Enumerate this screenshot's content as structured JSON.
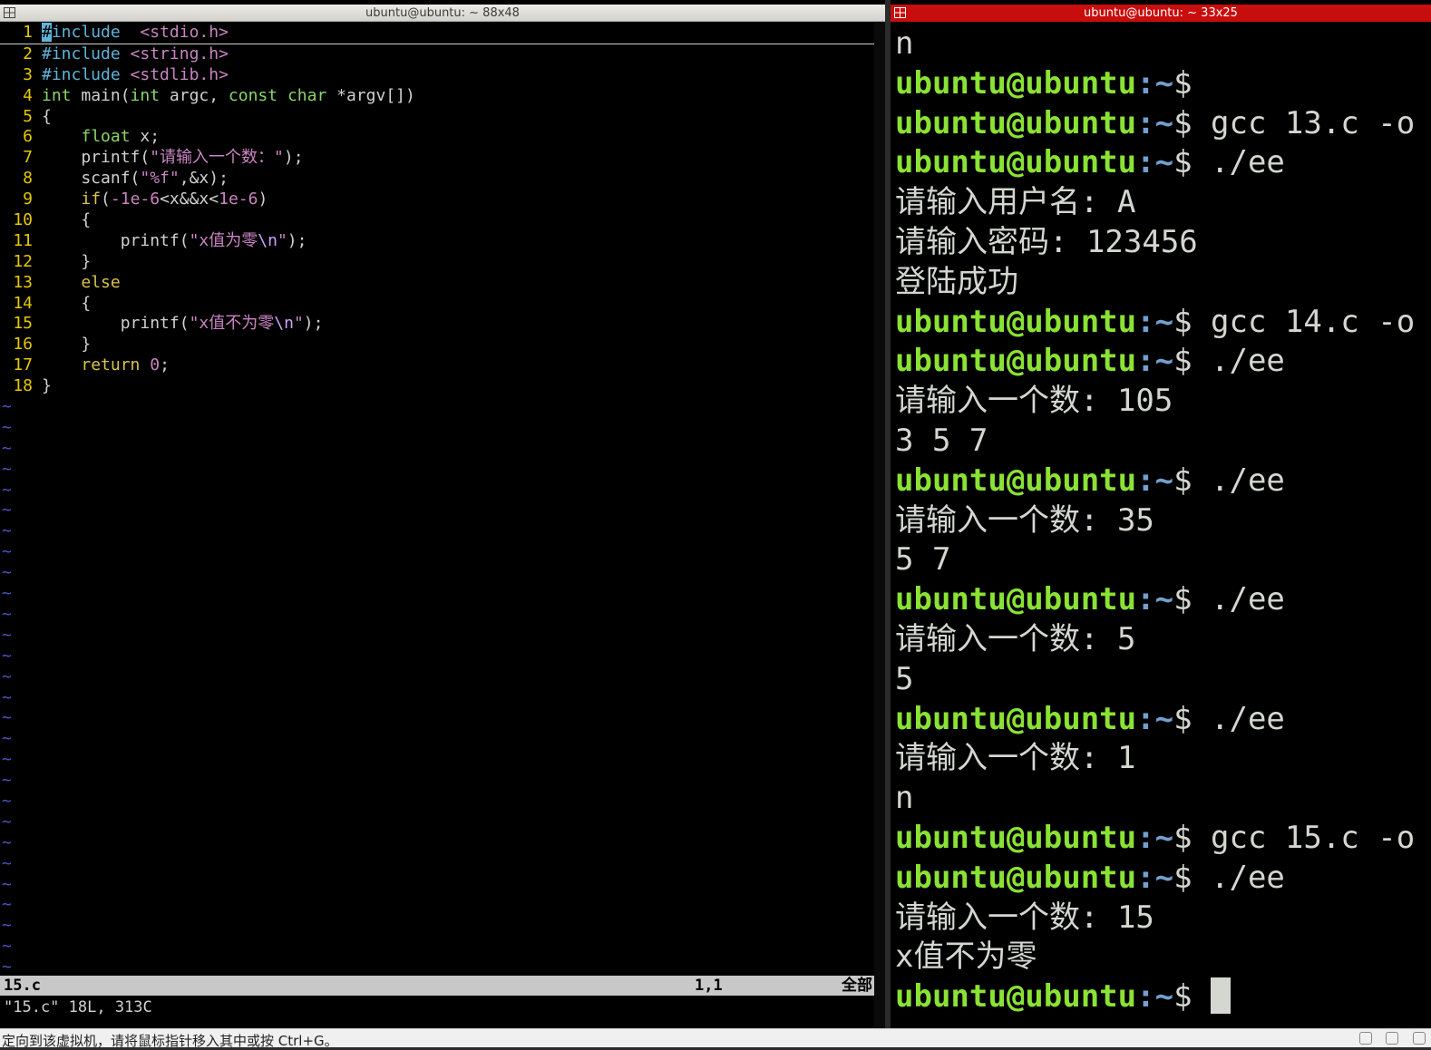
{
  "left_window": {
    "title": "ubuntu@ubuntu: ~ 88x48",
    "code": [
      {
        "n": "1",
        "parts": [
          [
            "cur",
            "#"
          ],
          [
            "c-pre",
            "include"
          ],
          [
            "",
            "  "
          ],
          [
            "c-inc",
            "<stdio.h>"
          ]
        ]
      },
      {
        "n": "2",
        "parts": [
          [
            "c-pre",
            "#include"
          ],
          [
            "",
            " "
          ],
          [
            "c-inc",
            "<string.h>"
          ]
        ]
      },
      {
        "n": "3",
        "parts": [
          [
            "c-pre",
            "#include"
          ],
          [
            "",
            " "
          ],
          [
            "c-inc",
            "<stdlib.h>"
          ]
        ]
      },
      {
        "n": "4",
        "parts": [
          [
            "c-type",
            "int"
          ],
          [
            "",
            " main("
          ],
          [
            "c-type",
            "int"
          ],
          [
            "",
            " argc, "
          ],
          [
            "c-type",
            "const"
          ],
          [
            "",
            " "
          ],
          [
            "c-type",
            "char"
          ],
          [
            "",
            " *argv[])"
          ]
        ]
      },
      {
        "n": "5",
        "parts": [
          [
            "",
            "{"
          ]
        ]
      },
      {
        "n": "6",
        "parts": [
          [
            "",
            "    "
          ],
          [
            "c-type",
            "float"
          ],
          [
            "",
            " x;"
          ]
        ]
      },
      {
        "n": "7",
        "parts": [
          [
            "",
            "    printf("
          ],
          [
            "c-str",
            "\"请输入一个数：\""
          ],
          [
            "",
            ");"
          ]
        ]
      },
      {
        "n": "8",
        "parts": [
          [
            "",
            "    scanf("
          ],
          [
            "c-str",
            "\"%f\""
          ],
          [
            "",
            ",&x);"
          ]
        ]
      },
      {
        "n": "9",
        "parts": [
          [
            "",
            "    "
          ],
          [
            "c-kw",
            "if"
          ],
          [
            "",
            "("
          ],
          [
            "c-num",
            "-1e-6"
          ],
          [
            "",
            "<x&&x<"
          ],
          [
            "c-num",
            "1e-6"
          ],
          [
            "",
            ")"
          ]
        ]
      },
      {
        "n": "10",
        "parts": [
          [
            "",
            "    {"
          ]
        ]
      },
      {
        "n": "11",
        "parts": [
          [
            "",
            "        printf("
          ],
          [
            "c-str",
            "\"x值为零"
          ],
          [
            "c-esc",
            "\\n"
          ],
          [
            "c-str",
            "\""
          ],
          [
            "",
            ");"
          ]
        ]
      },
      {
        "n": "12",
        "parts": [
          [
            "",
            "    }"
          ]
        ]
      },
      {
        "n": "13",
        "parts": [
          [
            "",
            "    "
          ],
          [
            "c-kw",
            "else"
          ]
        ]
      },
      {
        "n": "14",
        "parts": [
          [
            "",
            "    {"
          ]
        ]
      },
      {
        "n": "15",
        "parts": [
          [
            "",
            "        printf("
          ],
          [
            "c-str",
            "\"x值不为零"
          ],
          [
            "c-esc",
            "\\n"
          ],
          [
            "c-str",
            "\""
          ],
          [
            "",
            ");"
          ]
        ]
      },
      {
        "n": "16",
        "parts": [
          [
            "",
            "    }"
          ]
        ]
      },
      {
        "n": "17",
        "parts": [
          [
            "",
            "    "
          ],
          [
            "c-kw",
            "return"
          ],
          [
            "",
            " "
          ],
          [
            "c-num",
            "0"
          ],
          [
            "",
            ";"
          ]
        ]
      },
      {
        "n": "18",
        "parts": [
          [
            "",
            "}"
          ]
        ]
      }
    ],
    "tilde_char": "~",
    "tilde_count": 28,
    "status": {
      "filename": "15.c",
      "position": "1,1",
      "scroll": "全部"
    },
    "cmdline": "\"15.c\" 18L, 313C"
  },
  "right_window": {
    "title": "ubuntu@ubuntu: ~ 33x25",
    "prompt_user": "ubuntu@ubuntu",
    "prompt_path": ":~",
    "prompt_sym": "$",
    "lines": [
      {
        "type": "out",
        "text": "n"
      },
      {
        "type": "prompt",
        "cmd": ""
      },
      {
        "type": "prompt",
        "cmd": " gcc 13.c -o"
      },
      {
        "type": "prompt",
        "cmd": " ./ee"
      },
      {
        "type": "out",
        "text": "请输入用户名: A"
      },
      {
        "type": "out",
        "text": "请输入密码: 123456"
      },
      {
        "type": "out",
        "text": "登陆成功"
      },
      {
        "type": "prompt",
        "cmd": " gcc 14.c -o"
      },
      {
        "type": "prompt",
        "cmd": " ./ee"
      },
      {
        "type": "out",
        "text": "请输入一个数: 105"
      },
      {
        "type": "out",
        "text": "3 5 7"
      },
      {
        "type": "prompt",
        "cmd": " ./ee"
      },
      {
        "type": "out",
        "text": "请输入一个数: 35"
      },
      {
        "type": "out",
        "text": "5 7"
      },
      {
        "type": "prompt",
        "cmd": " ./ee"
      },
      {
        "type": "out",
        "text": "请输入一个数: 5"
      },
      {
        "type": "out",
        "text": "5"
      },
      {
        "type": "prompt",
        "cmd": " ./ee"
      },
      {
        "type": "out",
        "text": "请输入一个数: 1"
      },
      {
        "type": "out",
        "text": "n"
      },
      {
        "type": "prompt",
        "cmd": " gcc 15.c -o"
      },
      {
        "type": "prompt",
        "cmd": " ./ee"
      },
      {
        "type": "out",
        "text": "请输入一个数: 15"
      },
      {
        "type": "out",
        "text": "x值不为零"
      },
      {
        "type": "prompt",
        "cmd": " ",
        "cursor": true
      }
    ]
  },
  "vm_status": {
    "message": "定向到该虚拟机，请将鼠标指针移入其中或按 Ctrl+G。"
  },
  "colors": {
    "line_number": "#e5c800",
    "prompt_user": "#8ae234",
    "prompt_path": "#729fcf",
    "right_title_bar": "#c80d0d"
  }
}
